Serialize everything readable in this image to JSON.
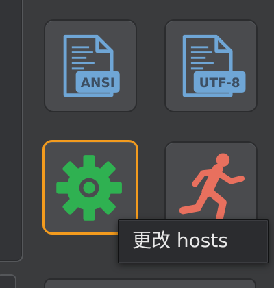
{
  "tiles": {
    "ansi": {
      "badge": "ANSI"
    },
    "utf8": {
      "badge": "UTF-8"
    },
    "hosts": {},
    "run": {}
  },
  "tooltip": {
    "text": "更改 hosts"
  },
  "colors": {
    "file_icon": "#6fa6d6",
    "gear": "#2fb151",
    "runner": "#e8705e",
    "selection": "#f39b1e",
    "tile_bg": "#4a4b4e",
    "background": "#3a3b3d"
  },
  "icons": {
    "ansi": "file-ansi-icon",
    "utf8": "file-utf8-icon",
    "hosts": "gear-icon",
    "run": "running-man-icon"
  }
}
